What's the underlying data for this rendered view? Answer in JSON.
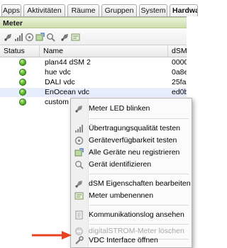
{
  "tabs": [
    {
      "label": "Apps",
      "active": false
    },
    {
      "label": "Aktivitäten",
      "active": false
    },
    {
      "label": "Räume",
      "active": false
    },
    {
      "label": "Gruppen",
      "active": false
    },
    {
      "label": "System",
      "active": false
    },
    {
      "label": "Hardware",
      "active": true
    }
  ],
  "section": {
    "title": "Meter"
  },
  "toolbar": {
    "icons": [
      "meter-config-icon",
      "signal-icon",
      "register-devices-icon",
      "register-icon",
      "identify-icon",
      "edit-icon",
      "rename-icon"
    ]
  },
  "table": {
    "columns": [
      "Status",
      "Name",
      "dSM"
    ],
    "rows": [
      {
        "status": "ok",
        "name": "plan44 dSM 2",
        "dsm": "0000"
      },
      {
        "status": "ok",
        "name": "hue vdc",
        "dsm": "0a8e"
      },
      {
        "status": "ok",
        "name": "DALI vdc",
        "dsm": "25fa"
      },
      {
        "status": "ok",
        "name": "EnOcean vdc",
        "dsm": "ed0b",
        "selected": true
      },
      {
        "status": "ok",
        "name": "custom io",
        "dsm": ""
      }
    ]
  },
  "context_menu": {
    "items": [
      {
        "label": "Meter LED blinken",
        "icon": "led-blink-icon",
        "disabled": false
      },
      {
        "label": "Übertragungsqualität testen",
        "icon": "signal-quality-icon",
        "disabled": false
      },
      {
        "label": "Geräteverfügbarkeit testen",
        "icon": "availability-icon",
        "disabled": false
      },
      {
        "label": "Alle Geräte neu registrieren",
        "icon": "register-all-icon",
        "disabled": false
      },
      {
        "label": "Gerät identifizieren",
        "icon": "identify-icon",
        "disabled": false
      },
      {
        "label": "dSM Eigenschaften bearbeiten",
        "icon": "properties-icon",
        "disabled": false
      },
      {
        "label": "Meter umbenennen",
        "icon": "rename-icon",
        "disabled": false
      },
      {
        "label": "Kommunikationslog ansehen",
        "icon": "log-icon",
        "disabled": false
      },
      {
        "label": "digitalSTROM-Meter löschen",
        "icon": "delete-icon",
        "disabled": true
      },
      {
        "label": "VDC Interface öffnen",
        "icon": "wrench-icon",
        "disabled": false
      }
    ]
  },
  "colors": {
    "status_ok": "#4caf28",
    "arrow": "#e8411f"
  }
}
